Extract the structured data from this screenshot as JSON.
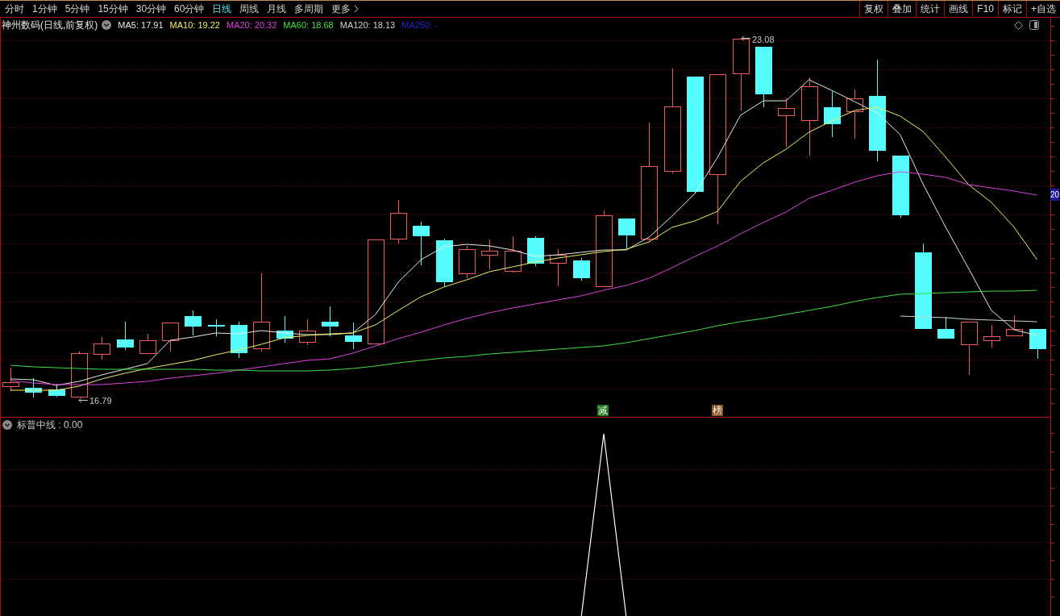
{
  "toolbar": {
    "periods": [
      {
        "label": "分时",
        "selected": false
      },
      {
        "label": "1分钟",
        "selected": false
      },
      {
        "label": "5分钟",
        "selected": false
      },
      {
        "label": "15分钟",
        "selected": false
      },
      {
        "label": "30分钟",
        "selected": false
      },
      {
        "label": "60分钟",
        "selected": false
      },
      {
        "label": "日线",
        "selected": true
      },
      {
        "label": "周线",
        "selected": false
      },
      {
        "label": "月线",
        "selected": false
      },
      {
        "label": "多周期",
        "selected": false
      }
    ],
    "more": {
      "label": "更多"
    },
    "actions": [
      "复权",
      "叠加",
      "统计",
      "画线",
      "F10",
      "标记",
      "+自选"
    ]
  },
  "price_chart": {
    "title": "神州数码(日线,前复权)",
    "moving_averages": [
      {
        "label": "MA5: 17.91",
        "color": "#e8e8e8"
      },
      {
        "label": "MA10: 19.22",
        "color": "#f0f060"
      },
      {
        "label": "MA20: 20.32",
        "color": "#e040e0"
      },
      {
        "label": "MA60: 18.68",
        "color": "#40e040"
      },
      {
        "label": "MA120: 18.13",
        "color": "#d0d0d0"
      },
      {
        "label": "MA250: -",
        "color": "#2424d0"
      }
    ],
    "high_label": "23.08",
    "low_label": "16.79",
    "event_tags": [
      {
        "text": "减",
        "color": "#1e7a1e"
      },
      {
        "text": "榜",
        "color": "#8a5520"
      }
    ],
    "axis_label": "20"
  },
  "indicator_pane": {
    "title": "标普中线 : 0.00"
  }
}
